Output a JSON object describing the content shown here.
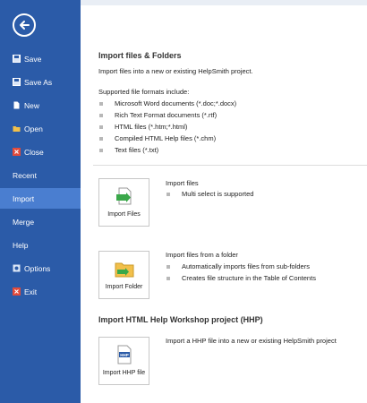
{
  "sidebar": {
    "items": [
      {
        "label": "Save",
        "icon": "save-icon"
      },
      {
        "label": "Save As",
        "icon": "save-as-icon"
      },
      {
        "label": "New",
        "icon": "new-icon"
      },
      {
        "label": "Open",
        "icon": "open-folder-icon"
      },
      {
        "label": "Close",
        "icon": "close-icon"
      },
      {
        "label": "Recent"
      },
      {
        "label": "Import",
        "active": true
      },
      {
        "label": "Merge"
      },
      {
        "label": "Help"
      },
      {
        "label": "Options",
        "icon": "options-icon"
      },
      {
        "label": "Exit",
        "icon": "exit-icon"
      }
    ]
  },
  "main": {
    "title": "Import files & Folders",
    "intro": "Import files into a new or existing HelpSmith project.",
    "formats_heading": "Supported file formats include:",
    "formats": [
      "Microsoft Word documents (*.doc;*.docx)",
      "Rich Text Format documents (*.rtf)",
      "HTML files (*.htm;*.html)",
      "Compiled HTML Help files (*.chm)",
      "Text files (*.txt)"
    ],
    "import_files": {
      "button_label": "Import Files",
      "heading": "Import files",
      "bullets": [
        "Multi select is supported"
      ]
    },
    "import_folder": {
      "button_label": "Import Folder",
      "heading": "Import files from a folder",
      "bullets": [
        "Automatically imports files from sub-folders",
        "Creates file structure in the Table of Contents"
      ]
    },
    "hhp_title": "Import HTML Help Workshop project (HHP)",
    "import_hhp": {
      "button_label": "Import HHP file",
      "description": "Import a HHP file into a new or existing HelpSmith project",
      "icon_text": "HHP"
    }
  },
  "colors": {
    "sidebar_bg": "#2b5ba8",
    "sidebar_active": "#4a7ed0"
  }
}
